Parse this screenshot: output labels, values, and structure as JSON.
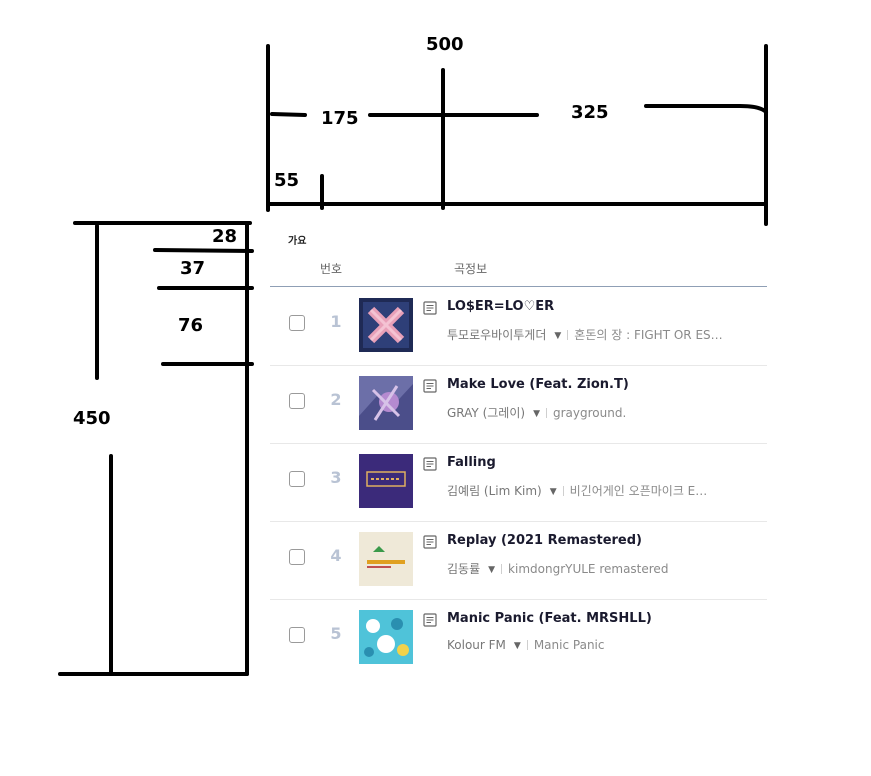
{
  "annotations": {
    "top": {
      "total": "500",
      "left_span": "175",
      "right_span": "325",
      "small": "55"
    },
    "left": {
      "total": "450",
      "category_gap": "28",
      "header_height": "37",
      "row_height": "76"
    }
  },
  "list": {
    "category": "가요",
    "columns": {
      "number": "번호",
      "song_info": "곡정보"
    },
    "songs": [
      {
        "rank": "1",
        "title": "LO$ER=LO♡ER",
        "artist": "투모로우바이투게더",
        "album": "혼돈의 장 : FIGHT OR ES…",
        "cover_colors": [
          "#1f2a55",
          "#e8a0b8"
        ]
      },
      {
        "rank": "2",
        "title": "Make Love (Feat. Zion.T)",
        "artist": "GRAY (그레이)",
        "album": "grayground.",
        "cover_colors": [
          "#6c6fa8",
          "#b58ad0"
        ]
      },
      {
        "rank": "3",
        "title": "Falling",
        "artist": "김예림 (Lim Kim)",
        "album": "비긴어게인 오픈마이크 E…",
        "cover_colors": [
          "#3b2a7a",
          "#e0b060"
        ]
      },
      {
        "rank": "4",
        "title": "Replay (2021 Remastered)",
        "artist": "김동률",
        "album": "kimdongrYULE remastered",
        "cover_colors": [
          "#efe9d8",
          "#e0a020"
        ]
      },
      {
        "rank": "5",
        "title": "Manic Panic (Feat. MRSHLL)",
        "artist": "Kolour FM",
        "album": "Manic Panic",
        "cover_colors": [
          "#4fc3d9",
          "#ffffff"
        ]
      }
    ]
  }
}
